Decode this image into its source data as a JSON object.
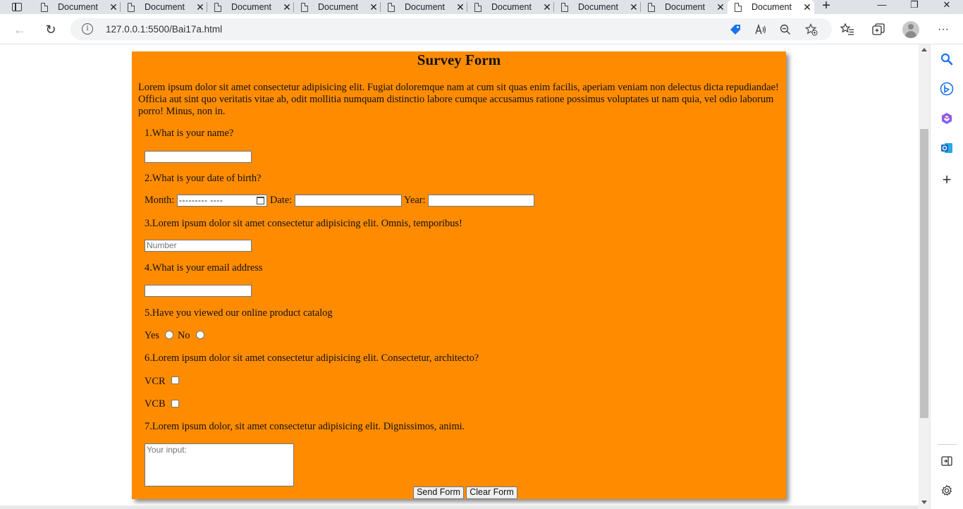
{
  "browser": {
    "tabs": [
      {
        "label": "Document",
        "active": false
      },
      {
        "label": "Document",
        "active": false
      },
      {
        "label": "Document",
        "active": false
      },
      {
        "label": "Document",
        "active": false
      },
      {
        "label": "Document",
        "active": false
      },
      {
        "label": "Document",
        "active": false
      },
      {
        "label": "Document",
        "active": false
      },
      {
        "label": "Document",
        "active": false
      },
      {
        "label": "Document",
        "active": true
      }
    ],
    "url": "127.0.0.1:5500/Bai17a.html",
    "icons": {
      "tab_close": "✕",
      "new_tab": "+",
      "minimize": "—",
      "restore": "❐",
      "window_close": "✕",
      "back": "←",
      "refresh": "↻",
      "info": "i",
      "more": "···"
    },
    "accent_color": "#1a73e8"
  },
  "form": {
    "title": "Survey Form",
    "intro": "Lorem ipsum dolor sit amet consectetur adipisicing elit. Fugiat doloremque nam at cum sit quas enim facilis, aperiam veniam non delectus dicta repudiandae! Officia aut sint quo veritatis vitae ab, odit mollitia numquam distinctio labore cumque accusamus ratione possimus voluptates ut nam quia, vel odio laborum porro! Minus, non in.",
    "background_color": "#ff8c00",
    "q1": "1.What is your name?",
    "q2": "2.What is your date of birth?",
    "month_label": "Month:",
    "month_value": "--------- ----",
    "date_label": "Date:",
    "year_label": "Year:",
    "q3": "3.Lorem ipsum dolor sit amet consectetur adipisicing elit. Omnis, temporibus!",
    "number_placeholder": "Number",
    "q4": "4.What is your email address",
    "q5": "5.Have you viewed our online product catalog",
    "yes_label": "Yes",
    "no_label": "No",
    "q6": "6.Lorem ipsum dolor sit amet consectetur adipisicing elit. Consectetur, architecto?",
    "vcr_label": "VCR",
    "vcb_label": "VCB",
    "q7": "7.Lorem ipsum dolor, sit amet consectetur adipisicing elit. Dignissimos, animi.",
    "textarea_placeholder": "Your input:",
    "send_label": "Send Form",
    "clear_label": "Clear Form"
  }
}
